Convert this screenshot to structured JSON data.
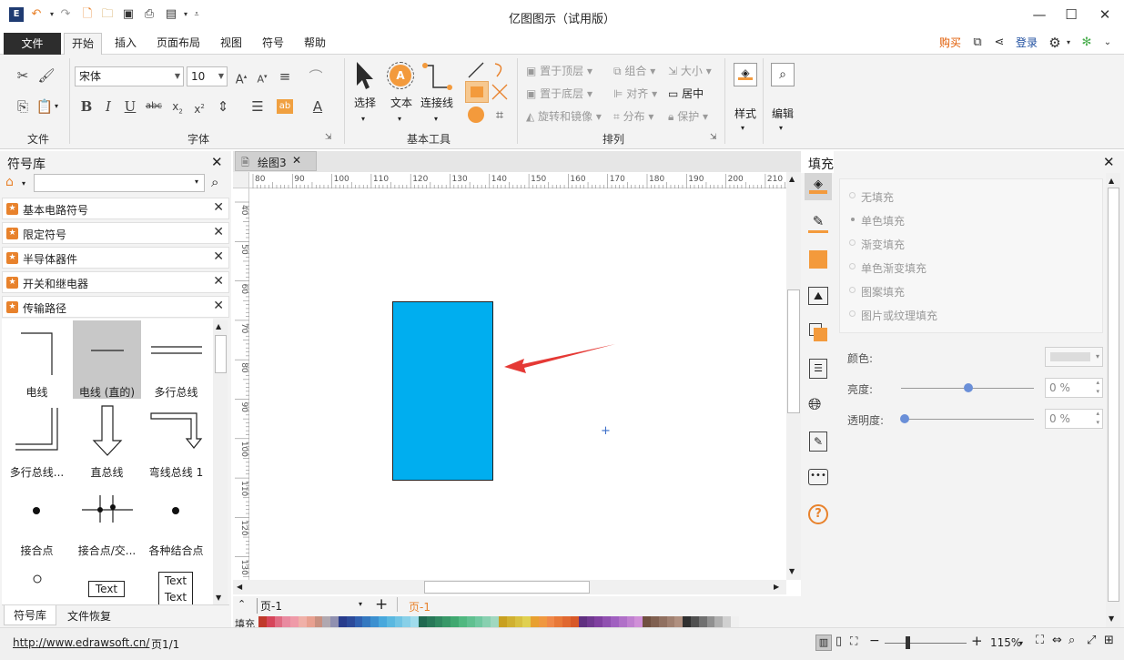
{
  "app": {
    "title": "亿图图示（试用版）"
  },
  "window": {
    "minimize": "—",
    "maximize": "☐",
    "close": "✕"
  },
  "menu": {
    "file": "文件",
    "home": "开始",
    "insert": "插入",
    "page_layout": "页面布局",
    "view": "视图",
    "symbol": "符号",
    "help": "帮助",
    "buy": "购买",
    "login": "登录"
  },
  "ribbon": {
    "groups": {
      "file": "文件",
      "font": "字体",
      "basic_tools": "基本工具",
      "arrange": "排列"
    },
    "font_name": "宋体",
    "font_size": "10",
    "tools": {
      "select": "选择",
      "text": "文本",
      "connector": "连接线",
      "style": "样式",
      "edit": "编辑"
    },
    "arrange": {
      "bring_front": "置于顶层",
      "send_back": "置于底层",
      "rotate_mirror": "旋转和镜像",
      "group": "组合",
      "align": "对齐",
      "distribute": "分布",
      "size": "大小",
      "center": "居中",
      "protect": "保护"
    }
  },
  "library": {
    "title": "符号库",
    "search_placeholder": "",
    "categories": [
      "基本电路符号",
      "限定符号",
      "半导体器件",
      "开关和继电器",
      "传输路径"
    ],
    "shapes": [
      "电线",
      "电线 (直的)",
      "多行总线",
      "多行总线...",
      "直总线",
      "弯线总线 1",
      "接合点",
      "接合点/交...",
      "各种结合点"
    ],
    "text_shape": "Text",
    "tabs": {
      "library": "符号库",
      "recovery": "文件恢复"
    }
  },
  "document": {
    "tab": "绘图3",
    "page_dropdown": "页-1",
    "page_tab": "页-1",
    "fill_label": "填充"
  },
  "ruler": {
    "top": [
      "80",
      "90",
      "100",
      "110",
      "120",
      "130",
      "140",
      "150",
      "160",
      "170",
      "180",
      "190",
      "200",
      "210"
    ],
    "left": [
      "40",
      "50",
      "60",
      "70",
      "80",
      "90",
      "100",
      "110",
      "120",
      "130"
    ]
  },
  "fill_panel": {
    "title": "填充",
    "options": [
      "无填充",
      "单色填充",
      "渐变填充",
      "单色渐变填充",
      "图案填充",
      "图片或纹理填充"
    ],
    "color_label": "颜色:",
    "brightness_label": "亮度:",
    "brightness_value": "0 %",
    "transparency_label": "透明度:",
    "transparency_value": "0 %"
  },
  "status": {
    "url": "http://www.edrawsoft.cn/",
    "page": "页1/1",
    "zoom": "115%"
  },
  "colors": {
    "shape_fill": "#00aeef",
    "arrow": "#e53935",
    "accent": "#e8822c",
    "buy": "#e05a00",
    "file_menu": "#2d2d2d"
  },
  "palette": [
    "#c0392b",
    "#d6455a",
    "#e06b82",
    "#e98aa0",
    "#ef9aa8",
    "#f0b0a8",
    "#e8a090",
    "#c89080",
    "#b0a8b0",
    "#9090b0",
    "#283c8c",
    "#2c4a9a",
    "#3060b0",
    "#3478c0",
    "#3c90d0",
    "#48a8dc",
    "#5ab8e0",
    "#70c4e4",
    "#88d0e8",
    "#a0dcec",
    "#206850",
    "#287858",
    "#308860",
    "#389868",
    "#40a870",
    "#50b880",
    "#60c090",
    "#70c8a0",
    "#88d0b0",
    "#a0d8c0",
    "#c8a020",
    "#d0b030",
    "#d8c040",
    "#e0d050",
    "#e8a030",
    "#f09840",
    "#f08848",
    "#e87838",
    "#e06830",
    "#d85828",
    "#603080",
    "#703890",
    "#8040a0",
    "#9050b0",
    "#a060c0",
    "#b070c8",
    "#c080d0",
    "#d090d8",
    "#705040",
    "#806050",
    "#907060",
    "#a08070",
    "#b09080",
    "#303030",
    "#505050",
    "#707070",
    "#909090",
    "#b0b0b0",
    "#d0d0d0",
    "#f0f0f0"
  ]
}
